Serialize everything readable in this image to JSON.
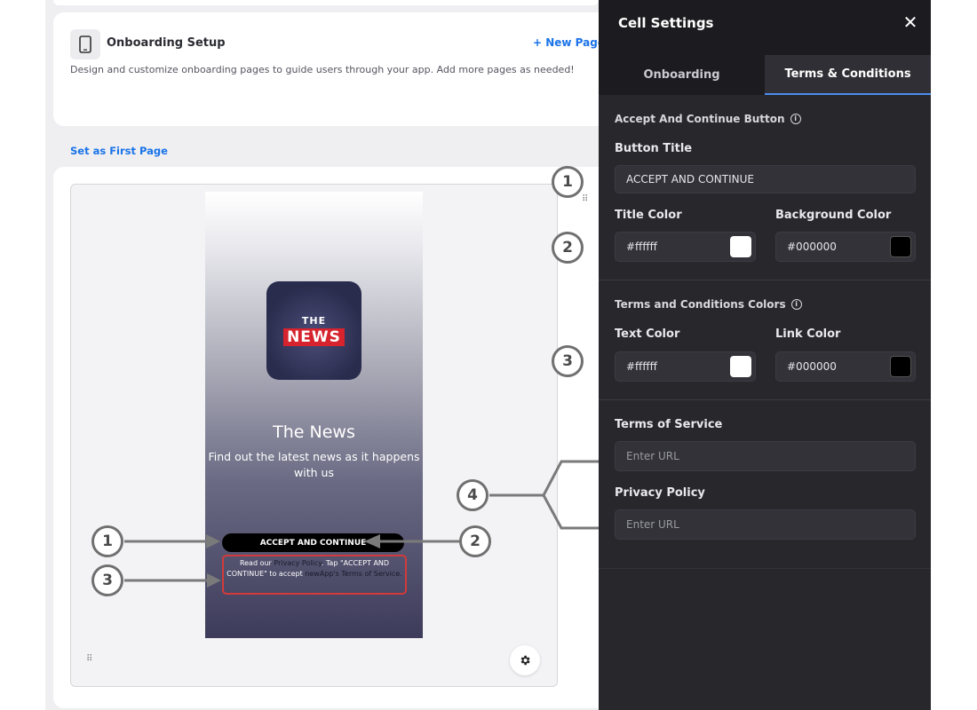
{
  "setup": {
    "title": "Onboarding Setup",
    "new_page": "+ New Page",
    "description": "Design and customize onboarding pages to guide users through your app. Add more pages as needed!",
    "set_first_page": "Set as First Page"
  },
  "preview": {
    "logo_top": "THE",
    "logo_bottom": "NEWS",
    "app_title": "The News",
    "tagline": "Find out the latest news as it happens with us",
    "accept_button": "ACCEPT AND CONTINUE",
    "terms_prefix": "Read our ",
    "terms_privacy_link": "Privacy Policy",
    "terms_mid": ". Tap \"ACCEPT AND CONTINUE\" to accept ",
    "terms_link2": "newApp's Terms of",
    "terms_suffix": " Service."
  },
  "callouts": {
    "one": "1",
    "two": "2",
    "three": "3",
    "four": "4"
  },
  "panel": {
    "title": "Cell Settings",
    "tabs": [
      {
        "label": "Onboarding",
        "active": false
      },
      {
        "label": "Terms & Conditions",
        "active": true
      }
    ],
    "accept_section": "Accept And Continue Button",
    "button_title_label": "Button Title",
    "button_title_value": "ACCEPT AND CONTINUE",
    "title_color_label": "Title Color",
    "title_color_value": "#ffffff",
    "bg_color_label": "Background Color",
    "bg_color_value": "#000000",
    "tc_section": "Terms and Conditions Colors",
    "text_color_label": "Text Color",
    "text_color_value": "#ffffff",
    "link_color_label": "Link Color",
    "link_color_value": "#000000",
    "tos_label": "Terms of Service",
    "tos_placeholder": "Enter URL",
    "privacy_label": "Privacy Policy",
    "privacy_placeholder": "Enter URL"
  },
  "icons": {
    "phone": "phone-icon",
    "close": "close-icon",
    "info": "info-icon",
    "gear": "gear-icon",
    "grip": "grip-icon"
  },
  "colors": {
    "accent": "#1a73e8",
    "panel_bg": "#27272c",
    "tab_underline": "#4d8cf0",
    "highlight_border": "#d33a3a",
    "logo_red": "#d6232d"
  }
}
